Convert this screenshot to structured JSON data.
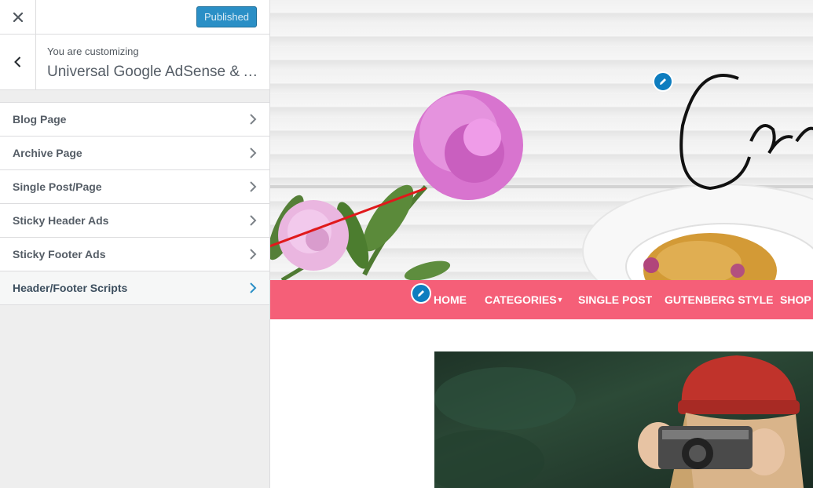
{
  "sidebar": {
    "publish_label": "Published",
    "info_subtitle": "You are customizing",
    "info_title": "Universal Google AdSense & Ads Manager",
    "items": [
      {
        "label": "Blog Page"
      },
      {
        "label": "Archive Page"
      },
      {
        "label": "Single Post/Page"
      },
      {
        "label": "Sticky Header Ads"
      },
      {
        "label": "Sticky Footer Ads"
      },
      {
        "label": "Header/Footer Scripts"
      }
    ]
  },
  "preview": {
    "logo_text": "Cre",
    "nav": {
      "home": "HOME",
      "categories": "CATEGORIES",
      "single_post": "SINGLE POST",
      "gutenberg": "GUTENBERG STYLE",
      "shop": "SHOP"
    }
  },
  "colors": {
    "nav_bg": "#f55f78",
    "publish_bg": "#2a8fc6",
    "annotation_arrow": "#e0191b",
    "edit_icon_bg": "#0e7dbf"
  },
  "icons": {
    "close": "close-icon",
    "back": "chevron-left-icon",
    "item_arrow": "chevron-right-icon",
    "edit": "pencil-icon"
  }
}
